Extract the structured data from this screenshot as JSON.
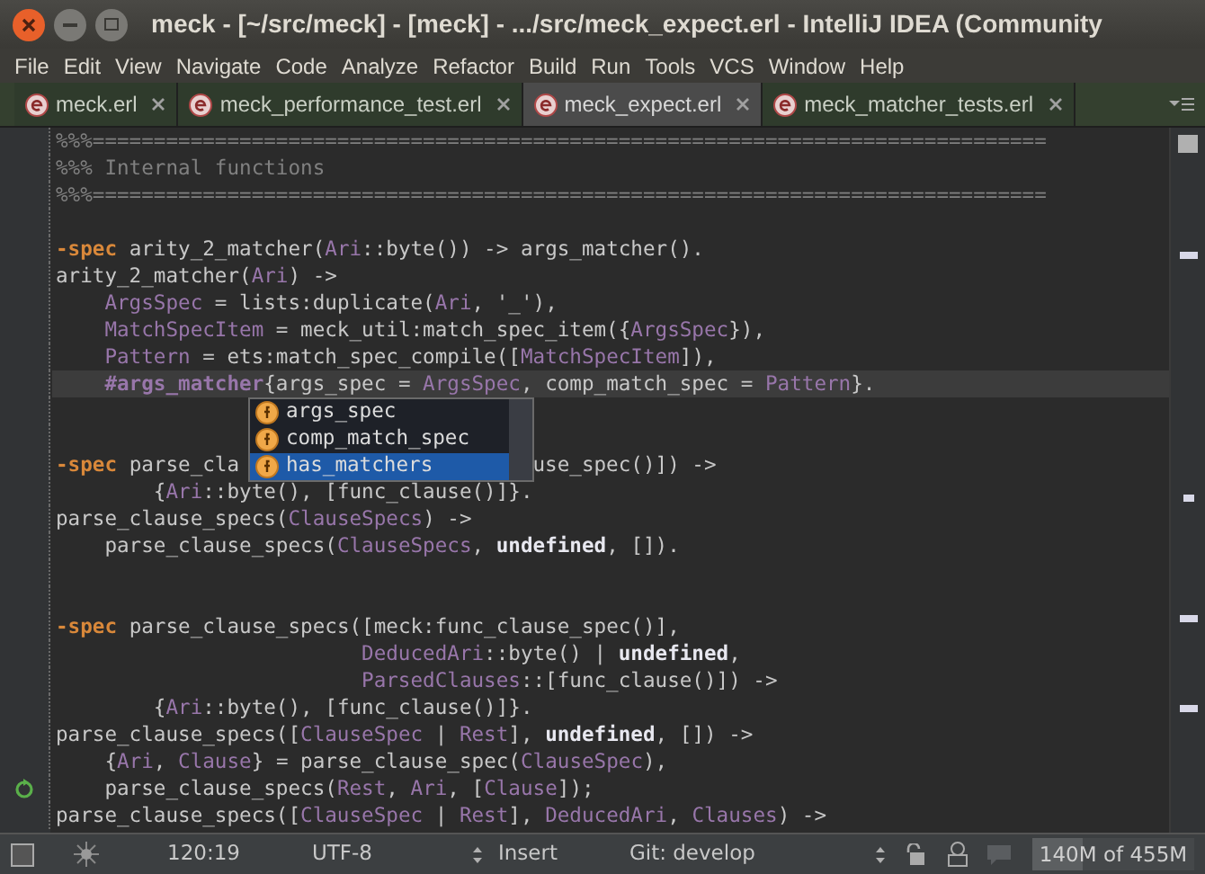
{
  "window": {
    "title": "meck - [~/src/meck] - [meck] - .../src/meck_expect.erl - IntelliJ IDEA (Community"
  },
  "menu": [
    "File",
    "Edit",
    "View",
    "Navigate",
    "Code",
    "Analyze",
    "Refactor",
    "Build",
    "Run",
    "Tools",
    "VCS",
    "Window",
    "Help"
  ],
  "tabs": [
    {
      "label": "meck.erl",
      "selected": false
    },
    {
      "label": "meck_performance_test.erl",
      "selected": false
    },
    {
      "label": "meck_expect.erl",
      "selected": true
    },
    {
      "label": "meck_matcher_tests.erl",
      "selected": false
    }
  ],
  "editor": {
    "lines": [
      {
        "current": false,
        "recursive": false,
        "parts": [
          [
            {
              "kind": "comment",
              "text": "%%%=============================================================================="
            }
          ]
        ]
      },
      {
        "current": false,
        "recursive": false,
        "parts": [
          [
            {
              "kind": "comment",
              "text": "%%% Internal functions"
            }
          ]
        ]
      },
      {
        "current": false,
        "recursive": false,
        "parts": [
          [
            {
              "kind": "comment",
              "text": "%%%=============================================================================="
            }
          ]
        ]
      },
      {
        "current": false,
        "recursive": false
      },
      {
        "current": false,
        "recursive": false,
        "parts": [
          [
            {
              "kind": "keyword",
              "text": "-spec"
            },
            {
              "kind": "plain",
              "text": " arity_2_matcher("
            },
            {
              "kind": "var",
              "text": "Ari"
            },
            {
              "kind": "plain",
              "text": "::byte()) -> args_matcher()."
            }
          ]
        ]
      },
      {
        "current": false,
        "recursive": false,
        "parts": [
          [
            {
              "kind": "plain",
              "text": "arity_2_matcher("
            },
            {
              "kind": "var",
              "text": "Ari"
            },
            {
              "kind": "plain",
              "text": ") ->"
            }
          ]
        ]
      },
      {
        "current": false,
        "recursive": false,
        "parts": [
          [
            {
              "kind": "var",
              "text": "    ArgsSpec"
            },
            {
              "kind": "plain",
              "text": " = lists:duplicate("
            },
            {
              "kind": "var",
              "text": "Ari"
            },
            {
              "kind": "plain",
              "text": ", '_'),"
            }
          ]
        ]
      },
      {
        "current": false,
        "recursive": false,
        "parts": [
          [
            {
              "kind": "var",
              "text": "    MatchSpecItem"
            },
            {
              "kind": "plain",
              "text": " = meck_util:match_spec_item({"
            },
            {
              "kind": "var",
              "text": "ArgsSpec"
            },
            {
              "kind": "plain",
              "text": "}),"
            }
          ]
        ]
      },
      {
        "current": false,
        "recursive": false,
        "parts": [
          [
            {
              "kind": "var",
              "text": "    Pattern"
            },
            {
              "kind": "plain",
              "text": " = ets:match_spec_compile(["
            },
            {
              "kind": "var",
              "text": "MatchSpecItem"
            },
            {
              "kind": "plain",
              "text": "]),"
            }
          ]
        ]
      },
      {
        "current": true,
        "recursive": false,
        "parts": [
          [
            {
              "kind": "record",
              "text": "    #args_matcher"
            },
            {
              "kind": "plain",
              "text": "{args_spec = "
            },
            {
              "kind": "var",
              "text": "ArgsSpec"
            },
            {
              "kind": "plain",
              "text": ", comp_match_spec = "
            },
            {
              "kind": "var",
              "text": "Pattern"
            },
            {
              "kind": "plain",
              "text": "}."
            }
          ]
        ]
      },
      {
        "current": false,
        "recursive": false
      },
      {
        "current": false,
        "recursive": false
      },
      {
        "current": false,
        "recursive": false,
        "parts": [
          [
            {
              "kind": "keyword",
              "text": "-spec"
            },
            {
              "kind": "plain",
              "text": " parse_cla"
            }
          ],
          [
            {
              "kind": "plain",
              "text": "use_spec()]) ->"
            }
          ]
        ]
      },
      {
        "current": false,
        "recursive": false,
        "parts": [
          [
            {
              "kind": "plain",
              "text": "        {"
            },
            {
              "kind": "var",
              "text": "Ari"
            },
            {
              "kind": "plain",
              "text": "::byte(), [func_clause()]}."
            }
          ]
        ]
      },
      {
        "current": false,
        "recursive": false,
        "parts": [
          [
            {
              "kind": "plain",
              "text": "parse_clause_specs("
            },
            {
              "kind": "var",
              "text": "ClauseSpecs"
            },
            {
              "kind": "plain",
              "text": ") ->"
            }
          ]
        ]
      },
      {
        "current": false,
        "recursive": false,
        "parts": [
          [
            {
              "kind": "plain",
              "text": "    parse_clause_specs("
            },
            {
              "kind": "var",
              "text": "ClauseSpecs"
            },
            {
              "kind": "plain",
              "text": ", "
            },
            {
              "kind": "bold",
              "text": "undefined"
            },
            {
              "kind": "plain",
              "text": ", [])."
            }
          ]
        ]
      },
      {
        "current": false,
        "recursive": false
      },
      {
        "current": false,
        "recursive": false
      },
      {
        "current": false,
        "recursive": false,
        "parts": [
          [
            {
              "kind": "keyword",
              "text": "-spec"
            },
            {
              "kind": "plain",
              "text": " parse_clause_specs([meck:func_clause_spec()],"
            }
          ]
        ]
      },
      {
        "current": false,
        "recursive": false,
        "parts": [
          [
            {
              "kind": "var",
              "text": "                         DeducedAri"
            },
            {
              "kind": "plain",
              "text": "::byte() | "
            },
            {
              "kind": "bold",
              "text": "undefined"
            },
            {
              "kind": "plain",
              "text": ","
            }
          ]
        ]
      },
      {
        "current": false,
        "recursive": false,
        "parts": [
          [
            {
              "kind": "var",
              "text": "                         ParsedClauses"
            },
            {
              "kind": "plain",
              "text": "::[func_clause()]) ->"
            }
          ]
        ]
      },
      {
        "current": false,
        "recursive": false,
        "parts": [
          [
            {
              "kind": "plain",
              "text": "        {"
            },
            {
              "kind": "var",
              "text": "Ari"
            },
            {
              "kind": "plain",
              "text": "::byte(), [func_clause()]}."
            }
          ]
        ]
      },
      {
        "current": false,
        "recursive": false,
        "parts": [
          [
            {
              "kind": "plain",
              "text": "parse_clause_specs(["
            },
            {
              "kind": "var",
              "text": "ClauseSpec"
            },
            {
              "kind": "plain",
              "text": " | "
            },
            {
              "kind": "var",
              "text": "Rest"
            },
            {
              "kind": "plain",
              "text": "], "
            },
            {
              "kind": "bold",
              "text": "undefined"
            },
            {
              "kind": "plain",
              "text": ", []) ->"
            }
          ]
        ]
      },
      {
        "current": false,
        "recursive": false,
        "parts": [
          [
            {
              "kind": "plain",
              "text": "    {"
            },
            {
              "kind": "var",
              "text": "Ari"
            },
            {
              "kind": "plain",
              "text": ", "
            },
            {
              "kind": "var",
              "text": "Clause"
            },
            {
              "kind": "plain",
              "text": "} = parse_clause_spec("
            },
            {
              "kind": "var",
              "text": "ClauseSpec"
            },
            {
              "kind": "plain",
              "text": "),"
            }
          ]
        ]
      },
      {
        "current": false,
        "recursive": true,
        "parts": [
          [
            {
              "kind": "plain",
              "text": "    parse_clause_specs("
            },
            {
              "kind": "var",
              "text": "Rest"
            },
            {
              "kind": "plain",
              "text": ", "
            },
            {
              "kind": "var",
              "text": "Ari"
            },
            {
              "kind": "plain",
              "text": ", ["
            },
            {
              "kind": "var",
              "text": "Clause"
            },
            {
              "kind": "plain",
              "text": "]);"
            }
          ]
        ]
      },
      {
        "current": false,
        "recursive": false,
        "parts": [
          [
            {
              "kind": "plain",
              "text": "parse_clause_specs(["
            },
            {
              "kind": "var",
              "text": "ClauseSpec"
            },
            {
              "kind": "plain",
              "text": " | "
            },
            {
              "kind": "var",
              "text": "Rest"
            },
            {
              "kind": "plain",
              "text": "], "
            },
            {
              "kind": "var",
              "text": "DeducedAri"
            },
            {
              "kind": "plain",
              "text": ", "
            },
            {
              "kind": "var",
              "text": "Clauses"
            },
            {
              "kind": "plain",
              "text": ") ->"
            }
          ]
        ]
      }
    ],
    "completion": [
      {
        "label": "args_spec",
        "selected": false
      },
      {
        "label": "comp_match_spec",
        "selected": false
      },
      {
        "label": "has_matchers",
        "selected": true
      }
    ]
  },
  "status_bar": {
    "position": "120:19",
    "encoding": "UTF-8",
    "mode": "Insert",
    "vcs": "Git: develop",
    "memory": {
      "text": "140M of 455M",
      "level": 0.31
    }
  }
}
